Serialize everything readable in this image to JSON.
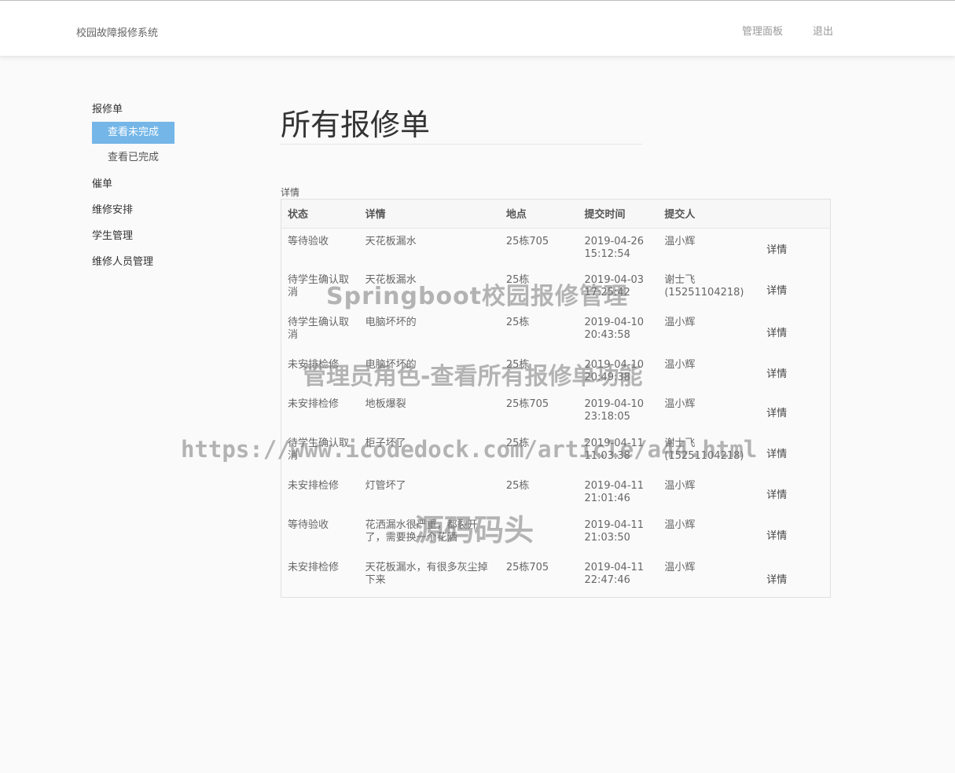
{
  "header": {
    "brand": "校园故障报修系统",
    "nav": [
      {
        "label": "管理面板"
      },
      {
        "label": "退出"
      }
    ]
  },
  "sidebar": {
    "groups": [
      {
        "label": "报修单",
        "items": [
          {
            "label": "查看未完成",
            "active": true
          },
          {
            "label": "查看已完成",
            "active": false
          }
        ]
      },
      {
        "label": "催单",
        "items": []
      },
      {
        "label": "维修安排",
        "items": []
      },
      {
        "label": "学生管理",
        "items": []
      },
      {
        "label": "维修人员管理",
        "items": []
      }
    ]
  },
  "main": {
    "title": "所有报修单",
    "caption": "详情",
    "columns": [
      "状态",
      "详情",
      "地点",
      "提交时间",
      "提交人",
      ""
    ],
    "rows": [
      {
        "status": "等待验收",
        "detail": "天花板漏水",
        "location": "25栋705",
        "time": "2019-04-26 15:12:54",
        "submitter": "温小辉",
        "action": "详情"
      },
      {
        "status": "待学生确认取消",
        "detail": "天花板漏水",
        "location": "25栋",
        "time": "2019-04-03 17:25:42",
        "submitter": "谢士飞(15251104218)",
        "action": "详情"
      },
      {
        "status": "待学生确认取消",
        "detail": "电脑坏坏的",
        "location": "25栋",
        "time": "2019-04-10 20:43:58",
        "submitter": "温小辉",
        "action": "详情"
      },
      {
        "status": "未安排检修",
        "detail": "电脑坏坏的",
        "location": "25栋",
        "time": "2019-04-10 20:49:38",
        "submitter": "温小辉",
        "action": "详情"
      },
      {
        "status": "未安排检修",
        "detail": "地板爆裂",
        "location": "25栋705",
        "time": "2019-04-10 23:18:05",
        "submitter": "温小辉",
        "action": "详情"
      },
      {
        "status": "待学生确认取消",
        "detail": "柜子坏了",
        "location": "25栋",
        "time": "2019-04-11 11:03:38",
        "submitter": "谢士飞(15251104218)",
        "action": "详情"
      },
      {
        "status": "未安排检修",
        "detail": "灯管坏了",
        "location": "25栋",
        "time": "2019-04-11 21:01:46",
        "submitter": "温小辉",
        "action": "详情"
      },
      {
        "status": "等待验收",
        "detail": "花洒漏水很严重，都裂开了，需要换一个花洒",
        "location": "",
        "time": "2019-04-11 21:03:50",
        "submitter": "温小辉",
        "action": "详情"
      },
      {
        "status": "未安排检修",
        "detail": "天花板漏水，有很多灰尘掉下来",
        "location": "25栋705",
        "time": "2019-04-11 22:47:46",
        "submitter": "温小辉",
        "action": "详情"
      }
    ]
  },
  "watermarks": {
    "line1": "Springboot校园报修管理",
    "line2": "管理员角色-查看所有报修单功能",
    "line3": "https://www.icodedock.com/article/a44.html",
    "line4": "源码码头"
  },
  "colors": {
    "accent": "#74b6e8"
  }
}
